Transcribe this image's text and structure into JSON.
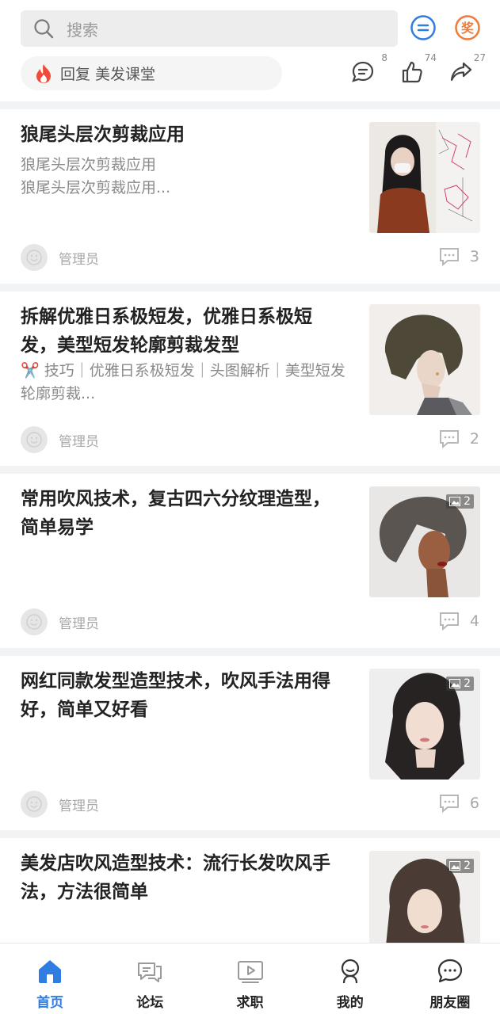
{
  "search": {
    "placeholder": "搜索"
  },
  "header_icons": {
    "message": "message-icon",
    "award": "award-icon",
    "award_char": "奖"
  },
  "hot": {
    "text": "回复 美发课堂"
  },
  "actions": {
    "comment_count": "8",
    "like_count": "74",
    "share_count": "27"
  },
  "posts": [
    {
      "title": "狼尾头层次剪裁应用",
      "excerpt": "狼尾头层次剪裁应用\n狼尾头层次剪裁应用...",
      "author": "管理员",
      "comments": "3"
    },
    {
      "title": "拆解优雅日系极短发，优雅日系极短发，美型短发轮廓剪裁发型",
      "excerpt": "✂️ 技巧｜优雅日系极短发｜头图解析｜美型短发轮廓剪裁...",
      "author": "管理员",
      "comments": "2"
    },
    {
      "title": "常用吹风技术，复古四六分纹理造型，简单易学",
      "excerpt": "",
      "author": "管理员",
      "comments": "4",
      "images": "2"
    },
    {
      "title": "网红同款发型造型技术，吹风手法用得好，简单又好看",
      "excerpt": "",
      "author": "管理员",
      "comments": "6",
      "images": "2"
    },
    {
      "title": "美发店吹风造型技术：流行长发吹风手法，方法很简单",
      "excerpt": "",
      "author": "",
      "comments": "",
      "images": "2"
    }
  ],
  "tabs": [
    {
      "label": "首页",
      "icon": "home-icon"
    },
    {
      "label": "论坛",
      "icon": "forum-icon"
    },
    {
      "label": "求职",
      "icon": "video-icon"
    },
    {
      "label": "我的",
      "icon": "profile-icon"
    },
    {
      "label": "朋友圈",
      "icon": "moments-icon"
    }
  ],
  "colors": {
    "accent": "#2f7de1",
    "award": "#f07a3a",
    "flame": "#f04a3a"
  }
}
